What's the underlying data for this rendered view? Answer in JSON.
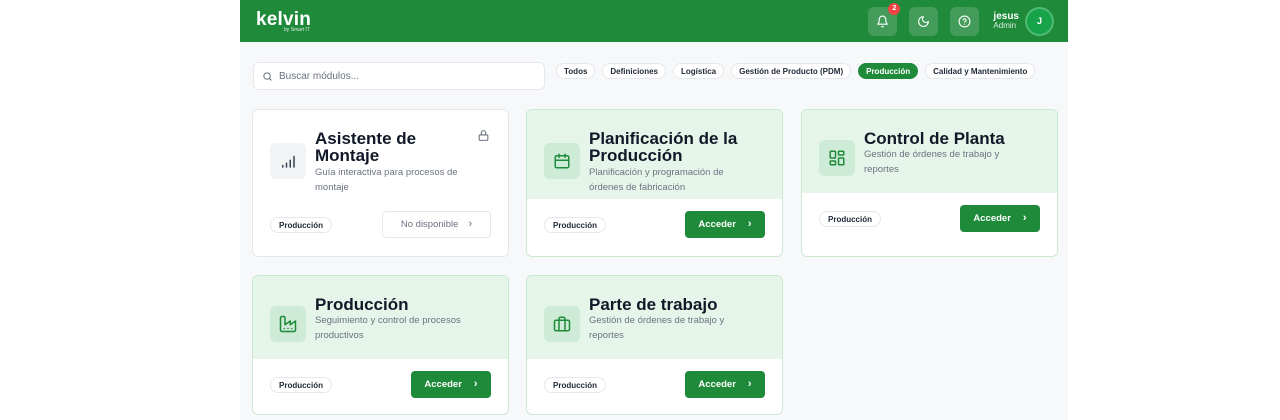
{
  "header": {
    "logo": "kelvin",
    "logo_sub": "by Smart IT",
    "notifications_count": "2",
    "user_name": "jesus",
    "user_role": "Admin",
    "avatar_initial": "J"
  },
  "search": {
    "placeholder": "Buscar módulos..."
  },
  "filters": [
    "Todos",
    "Definiciones",
    "Logística",
    "Gestión de Producto (PDM)",
    "Producción",
    "Calidad y Mantenimiento"
  ],
  "active_filter": "Producción",
  "cards": [
    {
      "title": "Asistente de Montaje",
      "description": "Guía interactiva para procesos de montaje",
      "tag": "Producción",
      "action": "No disponible",
      "available": false,
      "icon": "signal-bars-icon"
    },
    {
      "title": "Planificación de la Producción",
      "description": "Planificación y programación de órdenes de fabricación",
      "tag": "Producción",
      "action": "Acceder",
      "available": true,
      "icon": "calendar-icon"
    },
    {
      "title": "Control de Planta",
      "description": "Gestión de órdenes de trabajo y reportes",
      "tag": "Producción",
      "action": "Acceder",
      "available": true,
      "icon": "dashboard-grid-icon"
    },
    {
      "title": "Producción",
      "description": "Seguimiento y control de procesos productivos",
      "tag": "Producción",
      "action": "Acceder",
      "available": true,
      "icon": "factory-icon"
    },
    {
      "title": "Parte de trabajo",
      "description": "Gestión de órdenes de trabajo y reportes",
      "tag": "Producción",
      "action": "Acceder",
      "available": true,
      "icon": "briefcase-icon"
    }
  ],
  "colors": {
    "primary": "#1f8a3a",
    "card_tint": "#e6f5ea",
    "badge": "#ef4444"
  }
}
